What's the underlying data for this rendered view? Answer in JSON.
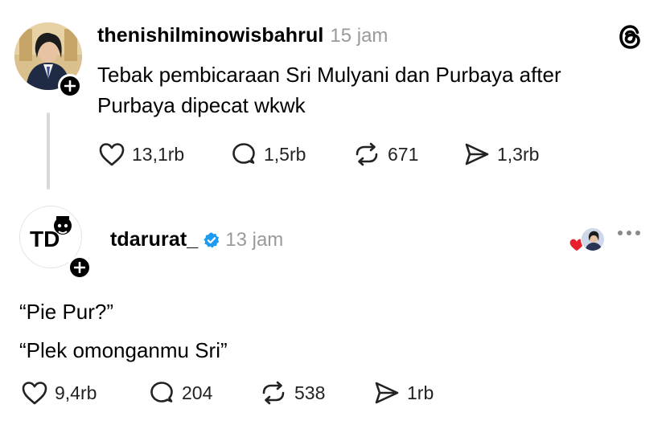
{
  "post1": {
    "username": "thenishilminowisbahrul",
    "time": "15 jam",
    "text_line1": "Tebak pembicaraan Sri Mulyani dan Purbaya after",
    "text_line2": "Purbaya dipecat wkwk",
    "likes": "13,1rb",
    "replies": "1,5rb",
    "reposts": "671",
    "shares": "1,3rb"
  },
  "post2": {
    "username": "tdarurat_",
    "time": "13 jam",
    "line1": "“Pie Pur?”",
    "line2": "“Plek omonganmu Sri”",
    "likes": "9,4rb",
    "replies": "204",
    "reposts": "538",
    "shares": "1rb",
    "avatar_text": "TD"
  },
  "icons": {
    "app": "threads-logo-icon",
    "like": "heart-icon",
    "reply": "comment-icon",
    "repost": "repost-icon",
    "share": "send-icon",
    "more": "more-icon",
    "verified": "verified-badge-icon",
    "follow": "plus-icon"
  },
  "colors": {
    "verified": "#1d9bf0",
    "liked_heart": "#e8202e",
    "muted": "#9a9a9a",
    "thread_line": "#d9d9d9"
  }
}
